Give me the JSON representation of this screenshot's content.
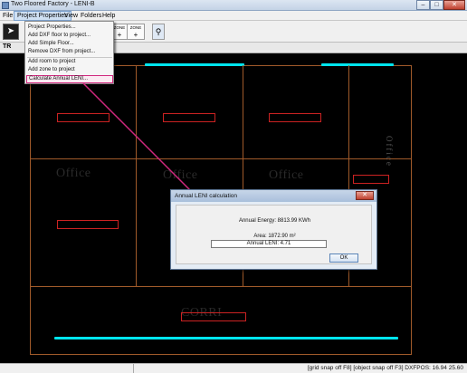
{
  "window": {
    "title": "Two Floored Factory - LENI-B",
    "buttons": {
      "minimize": "–",
      "maximize": "□",
      "close": "✕"
    }
  },
  "menu": {
    "items": [
      "File",
      "Project Properties",
      "View",
      "Folders",
      "Help"
    ],
    "open_menu": "Project Properties",
    "dropdown": [
      "Project Properties...",
      "Add DXF floor to project...",
      "Add Simple Floor...",
      "Remove DXF from project...",
      "Add room to project",
      "Add zone to project",
      "Calculate Annual LENI..."
    ],
    "highlighted_item": "Calculate Annual LENI..."
  },
  "toolbar": {
    "left_button_icon": "cursor-icon",
    "btn1": {
      "top": "ZONE",
      "bottom": "+"
    },
    "btn2": {
      "top": "ZONE",
      "bottom": "+"
    },
    "pin_icon": "pin-icon",
    "tab_label": "TR"
  },
  "canvas": {
    "rooms": [
      "Office",
      "Office",
      "Office",
      "Office",
      "CORRI"
    ],
    "vertical_text": "Office",
    "accent_color": "#00e5ee",
    "wall_color": "#a05a2a"
  },
  "dialog": {
    "title": "Annual LENI calculation",
    "energy": "Annual Energy: 8813.99 KWh",
    "area": "Area: 1872.90 m²",
    "result": "Annual LENI: 4.71",
    "ok": "OK",
    "close": "✕"
  },
  "status": {
    "text": "[grid snap off F8] [object snap off F3]  DXFPOS: 16.94 25.60"
  }
}
